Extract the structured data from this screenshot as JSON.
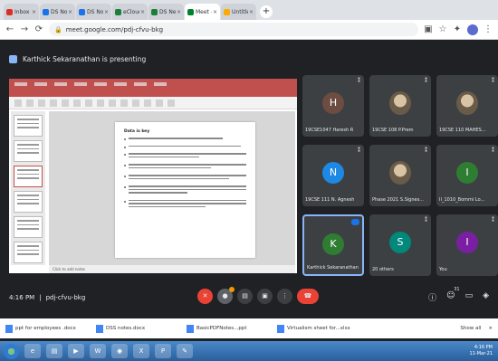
{
  "browser": {
    "tabs": [
      {
        "label": "Inbox (2) - k...",
        "color": "#d93025",
        "active": false
      },
      {
        "label": "DS Notes...",
        "color": "#1a73e8",
        "active": false
      },
      {
        "label": "DS Notes...",
        "color": "#1a73e8",
        "active": false
      },
      {
        "label": "eCloud ph...",
        "color": "#188038",
        "active": false
      },
      {
        "label": "DS Nemo...",
        "color": "#188038",
        "active": false
      },
      {
        "label": "Meet - p...",
        "color": "#00832d",
        "active": true
      },
      {
        "label": "Untitled...",
        "color": "#f9ab00",
        "active": false
      }
    ],
    "new_tab": "+",
    "url": "meet.google.com/pdj-cfvu-bkg"
  },
  "banner": {
    "text": "Karthick Sekaranathan is presenting"
  },
  "slide": {
    "title": "Data is key",
    "notes": "Click to add notes"
  },
  "participants": [
    {
      "name": "19CSE1047 Haresh R",
      "initial": "H",
      "color": "#6d4c41",
      "photo": false
    },
    {
      "name": "19CSE 108 P.Prem",
      "initial": "",
      "color": "",
      "photo": true
    },
    {
      "name": "19CSE 110 MAHES...",
      "initial": "",
      "color": "",
      "photo": true
    },
    {
      "name": "19CSE 111 N. Agnesh",
      "initial": "N",
      "color": "#1e88e5",
      "photo": false
    },
    {
      "name": "Phase 2021 S.Signes...",
      "initial": "",
      "color": "",
      "photo": true
    },
    {
      "name": "II_1010_Bommi Lo...",
      "initial": "I",
      "color": "#2e7d32",
      "photo": false
    },
    {
      "name": "Karthick Sekaranathan",
      "initial": "K",
      "color": "#2e7d32",
      "photo": false,
      "speaking": true
    },
    {
      "name": "20 others",
      "initial": "S",
      "color": "#00897b",
      "photo": false
    },
    {
      "name": "You",
      "initial": "I",
      "color": "#7b1fa2",
      "photo": false
    }
  ],
  "meeting": {
    "time": "4:16 PM",
    "separator": "|",
    "code": "pdj-cfvu-bkg",
    "people_count": "31"
  },
  "downloads": [
    {
      "name": "ppt for employees .docx"
    },
    {
      "name": "DSS notes.docx"
    },
    {
      "name": "BasicPDFNotes...ppt"
    },
    {
      "name": "Virtualism sheet for...xlsx"
    }
  ],
  "shelf": {
    "show_all": "Show all",
    "close": "×"
  },
  "taskbar": {
    "time": "4:16 PM",
    "date": "11-Mar-21"
  }
}
